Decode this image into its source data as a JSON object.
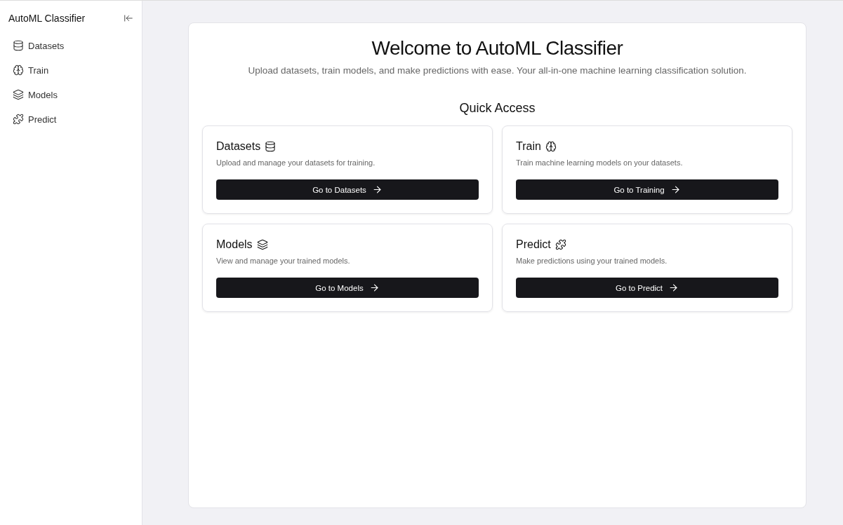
{
  "sidebar": {
    "title": "AutoML Classifier",
    "items": [
      {
        "label": "Datasets",
        "kind": "database"
      },
      {
        "label": "Train",
        "kind": "brain"
      },
      {
        "label": "Models",
        "kind": "layers"
      },
      {
        "label": "Predict",
        "kind": "puzzle"
      }
    ]
  },
  "hero": {
    "title": "Welcome to AutoML Classifier",
    "subtitle": "Upload datasets, train models, and make predictions with ease. Your all-in-one machine learning classification solution."
  },
  "quick_access": {
    "title": "Quick Access",
    "cards": [
      {
        "title": "Datasets",
        "kind": "database",
        "description": "Upload and manage your datasets for training.",
        "button": "Go to Datasets"
      },
      {
        "title": "Train",
        "kind": "brain",
        "description": "Train machine learning models on your datasets.",
        "button": "Go to Training"
      },
      {
        "title": "Models",
        "kind": "layers",
        "description": "View and manage your trained models.",
        "button": "Go to Models"
      },
      {
        "title": "Predict",
        "kind": "puzzle",
        "description": "Make predictions using your trained models.",
        "button": "Go to Predict"
      }
    ]
  }
}
